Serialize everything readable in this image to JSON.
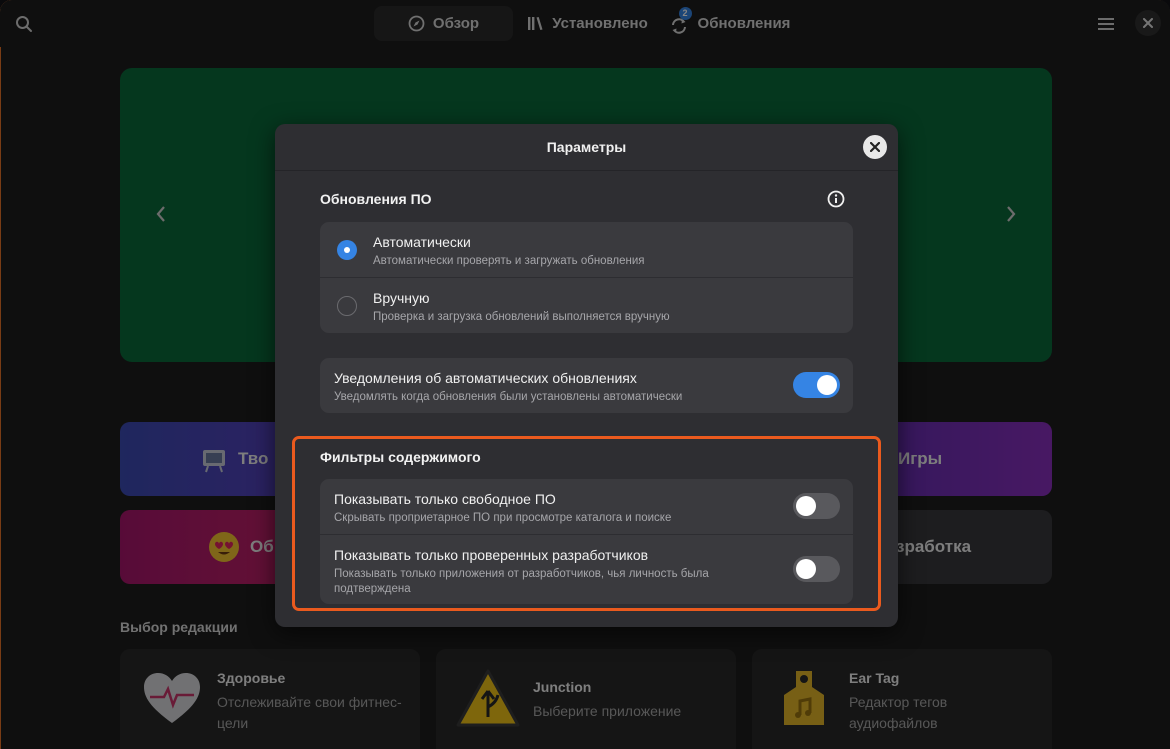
{
  "header": {
    "tabs": [
      {
        "label": "Обзор",
        "active": true
      },
      {
        "label": "Установлено",
        "active": false
      },
      {
        "label": "Обновления",
        "active": false,
        "badge": "2"
      }
    ]
  },
  "background": {
    "categories": [
      {
        "label": "Тво",
        "color": "#5a3fc0"
      },
      {
        "label": "Игры",
        "color": "#6b2fc7"
      },
      {
        "label": "Об",
        "color": "#c01f6a"
      },
      {
        "label": "зработка",
        "color": "#3a3a3e"
      }
    ],
    "editors_choice_title": "Выбор редакции",
    "apps": [
      {
        "name": "Здоровье",
        "description": "Отслеживайте свои фитнес-цели",
        "icon": "heart-icon"
      },
      {
        "name": "Junction",
        "description": "Выберите приложение",
        "icon": "road-sign-icon"
      },
      {
        "name": "Ear Tag",
        "description": "Редактор тегов аудиофайлов",
        "icon": "ear-tag-icon"
      }
    ]
  },
  "dialog": {
    "title": "Параметры",
    "updates_group": {
      "title": "Обновления ПО",
      "options": [
        {
          "title": "Автоматически",
          "subtitle": "Автоматически проверять и загружать обновления",
          "selected": true
        },
        {
          "title": "Вручную",
          "subtitle": "Проверка и загрузка обновлений выполняется вручную",
          "selected": false
        }
      ]
    },
    "notifications": {
      "title": "Уведомления об автоматических обновлениях",
      "subtitle": "Уведомлять когда обновления были установлены автоматически",
      "enabled": true
    },
    "content_filters": {
      "title": "Фильтры содержимого",
      "rows": [
        {
          "title": "Показывать только свободное ПО",
          "subtitle": "Скрывать проприетарное ПО при просмотре каталога и поиске",
          "enabled": false
        },
        {
          "title": "Показывать только проверенных разработчиков",
          "subtitle": "Показывать только приложения от разработчиков, чья личность была подтверждена",
          "enabled": false
        }
      ]
    }
  },
  "colors": {
    "accent": "#3584e4",
    "highlight": "#ea5a1e",
    "banner": "#0b6a3a"
  }
}
